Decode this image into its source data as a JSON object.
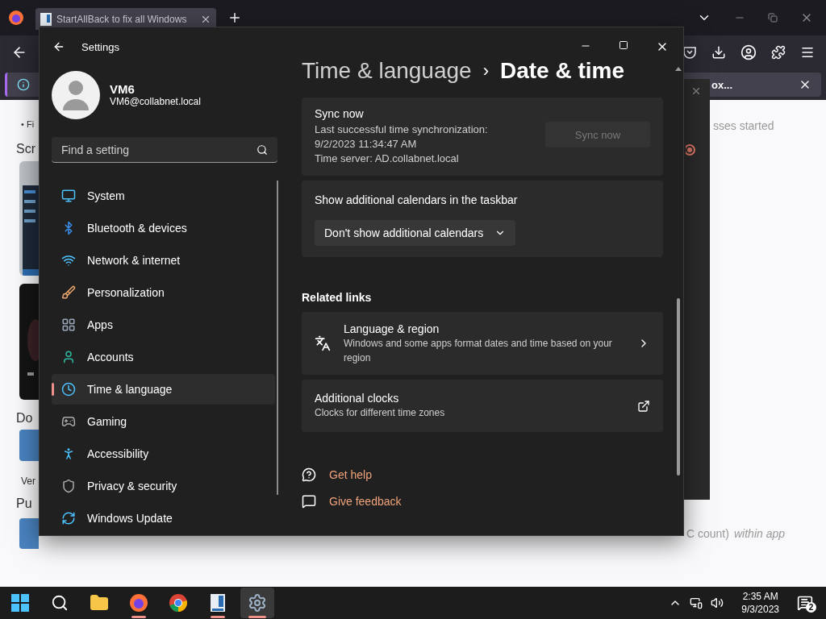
{
  "browser": {
    "tab_title": "StartAllBack to fix all Windows",
    "notification_text": "ox...",
    "page_texts": [
      {
        "kind": "bullet",
        "text": "• Fi"
      },
      {
        "kind": "heading",
        "text": "Scr"
      },
      {
        "kind": "heading",
        "text": "Do"
      },
      {
        "kind": "small",
        "text": "Ver"
      },
      {
        "kind": "heading",
        "text": "Pu"
      },
      {
        "kind": "body",
        "text": "sses started"
      },
      {
        "kind": "body",
        "text": "C count)"
      },
      {
        "kind": "italic",
        "text": "within app"
      }
    ]
  },
  "settings": {
    "title": "Settings",
    "user": {
      "name": "VM6",
      "email": "VM6@collabnet.local"
    },
    "search": {
      "placeholder": "Find a setting"
    },
    "nav": [
      {
        "label": "System",
        "selected": false
      },
      {
        "label": "Bluetooth & devices",
        "selected": false
      },
      {
        "label": "Network & internet",
        "selected": false
      },
      {
        "label": "Personalization",
        "selected": false
      },
      {
        "label": "Apps",
        "selected": false
      },
      {
        "label": "Accounts",
        "selected": false
      },
      {
        "label": "Time & language",
        "selected": true
      },
      {
        "label": "Gaming",
        "selected": false
      },
      {
        "label": "Accessibility",
        "selected": false
      },
      {
        "label": "Privacy & security",
        "selected": false
      },
      {
        "label": "Windows Update",
        "selected": false
      }
    ],
    "breadcrumb": {
      "parent": "Time & language",
      "separator": "›",
      "current": "Date & time"
    },
    "sync": {
      "title": "Sync now",
      "lines": [
        "Last successful time synchronization:",
        "9/2/2023 11:34:47 AM",
        "Time server: AD.collabnet.local"
      ],
      "button": {
        "label": "Sync now",
        "disabled": true
      }
    },
    "calendars": {
      "label": "Show additional calendars in the taskbar",
      "dropdown": {
        "value": "Don't show additional calendars"
      }
    },
    "related_heading": "Related links",
    "related_links": [
      {
        "kind": "chevron",
        "title": "Language & region",
        "description": "Windows and some apps format dates and time based on your region"
      },
      {
        "kind": "external",
        "title": "Additional clocks",
        "description": "Clocks for different time zones"
      }
    ],
    "help_links": [
      "Get help",
      "Give feedback"
    ]
  },
  "taskbar": {
    "apps": [
      {
        "running": false,
        "selected": false
      },
      {
        "running": false,
        "selected": false
      },
      {
        "running": false,
        "selected": false
      },
      {
        "running": true,
        "selected": false
      },
      {
        "running": false,
        "selected": false
      },
      {
        "running": true,
        "selected": false
      },
      {
        "running": true,
        "selected": true
      }
    ],
    "time": "2:35 AM",
    "date": "9/3/2023",
    "notification_count": "2"
  }
}
